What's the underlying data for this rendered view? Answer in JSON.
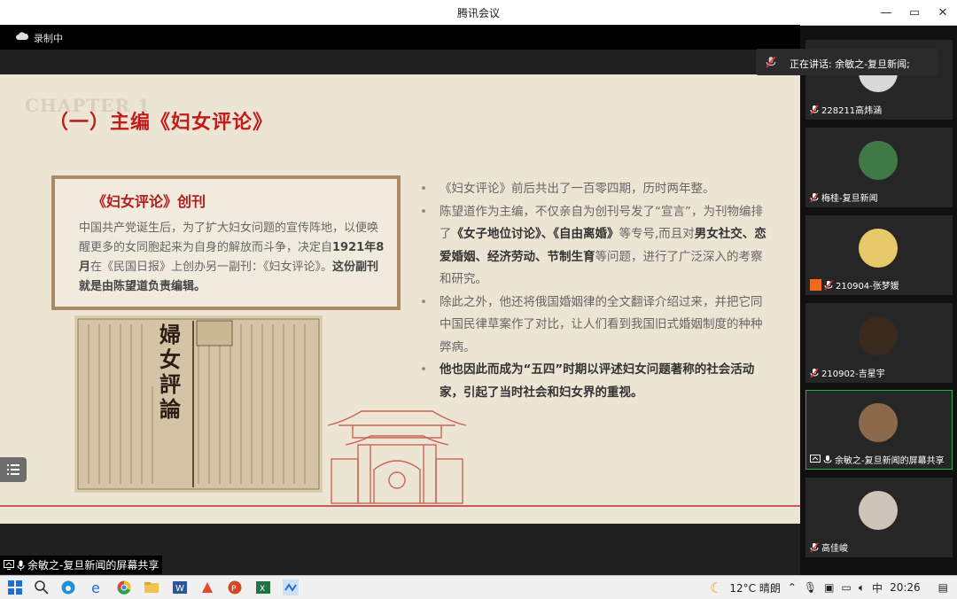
{
  "window": {
    "title": "腾讯会议",
    "minimize": "—",
    "restore": "▭",
    "close": "✕"
  },
  "recording": {
    "label": "录制中"
  },
  "slide": {
    "chapter": "CHAPTER 1",
    "title": "（一）主编《妇女评论》",
    "box_heading": "《妇女评论》创刊",
    "box_text_1": "中国共产党诞生后，为了扩大妇女问题的宣传阵地，以便唤醒更多的女同胞起来为自身的解放而斗争，决定自",
    "box_text_bold_1": "1921年8月",
    "box_text_2": "在《民国日报》上创办另一副刊：《妇女评论》。",
    "box_text_bold_2": "这份副刊就是由陈望道负责编辑。",
    "newspaper_masthead": "婦女評論",
    "bullet1": "《妇女评论》前后共出了一百零四期，历时两年整。",
    "bullet2_a": "陈望道作为主编，不仅亲自为创刊号发了“宣言”，为刊物编排了",
    "bullet2_b": "《女子地位讨论》、《自由离婚》",
    "bullet2_c": "等专号,而且对",
    "bullet2_d": "男女社交、恋爱婚姻、经济劳动、节制生育",
    "bullet2_e": "等问题，进行了广泛深入的考察和研究。",
    "bullet3": "除此之外，他还将俄国婚姻律的全文翻译介绍过来，并把它同中国民律草案作了对比，让人们看到我国旧式婚姻制度的种种弊病。",
    "bullet4": "他也因此而成为“五四”时期以评述妇女问题著称的社会活动家，引起了当时社会和妇女界的重视。"
  },
  "share_bar": {
    "label": "余敏之-复旦新闻的屏幕共享"
  },
  "speaking": {
    "label": "正在讲话: 余敏之-复旦新闻;"
  },
  "participants": [
    {
      "name": "228211高炜涵"
    },
    {
      "name": "梅桂-复旦新闻"
    },
    {
      "name": "210904-张梦媛"
    },
    {
      "name": "210902-吉星宇"
    },
    {
      "name": "余敏之-复旦新闻的屏幕共享"
    },
    {
      "name": "高佳峻"
    }
  ],
  "taskbar": {
    "weather": "12°C 晴朗",
    "ime": "中",
    "time": "20:26"
  },
  "colors": {
    "accent_red": "#c01c1c",
    "active_border": "#2ea84f"
  }
}
